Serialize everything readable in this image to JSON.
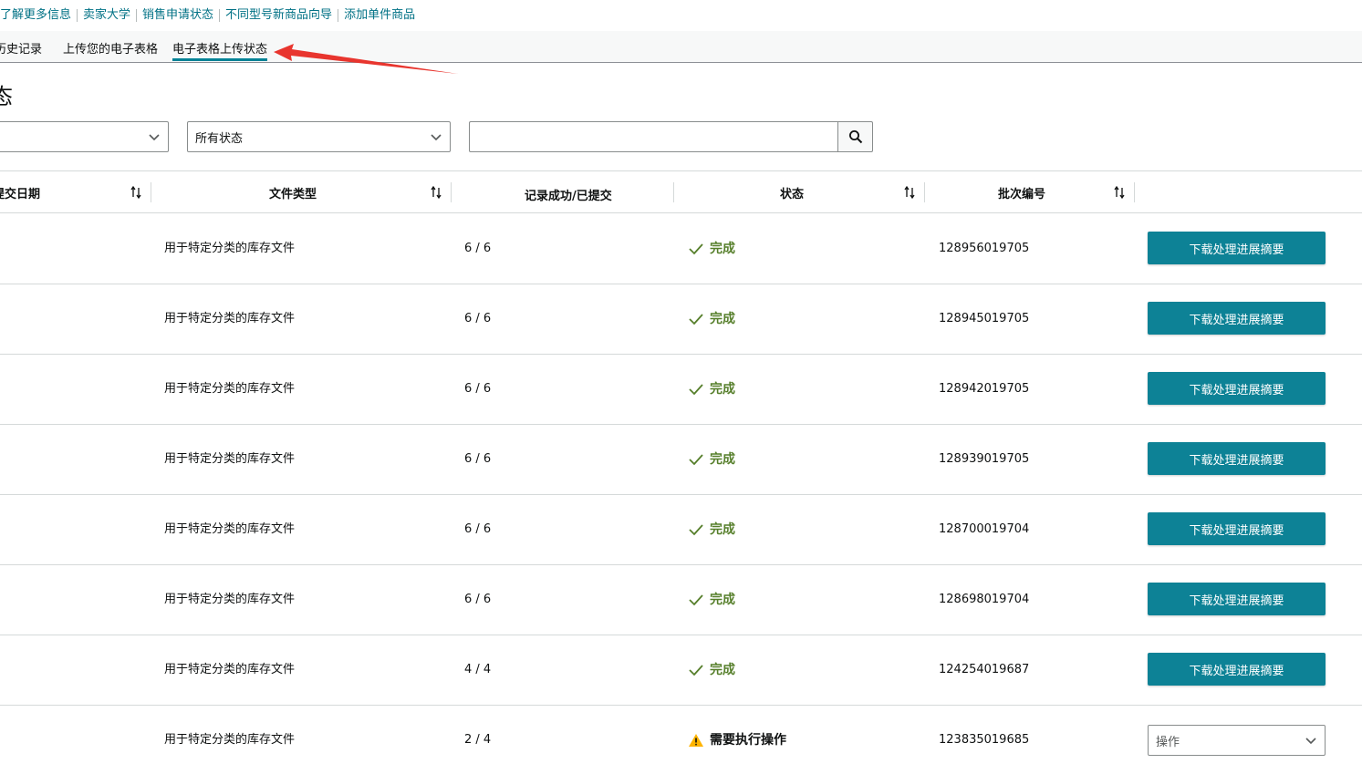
{
  "top_links": [
    "了解更多信息",
    "卖家大学",
    "销售申请状态",
    "不同型号新商品向导",
    "添加单件商品"
  ],
  "tabs": [
    {
      "label": "历史记录",
      "active": false
    },
    {
      "label": "上传您的电子表格",
      "active": false
    },
    {
      "label": "电子表格上传状态",
      "active": true
    }
  ],
  "page_title": "态",
  "filters": {
    "first_select_value": "",
    "status_select_value": "所有状态",
    "search_value": "",
    "search_icon": "search-icon"
  },
  "table": {
    "headers": [
      "提交日期",
      "文件类型",
      "记录成功/已提交",
      "状态",
      "批次编号",
      ""
    ],
    "rows": [
      {
        "file_type": "用于特定分类的库存文件",
        "records": "6 / 6",
        "status": "完成",
        "status_kind": "done",
        "batch": "128956019705",
        "action": "下载处理进展摘要"
      },
      {
        "file_type": "用于特定分类的库存文件",
        "records": "6 / 6",
        "status": "完成",
        "status_kind": "done",
        "batch": "128945019705",
        "action": "下载处理进展摘要"
      },
      {
        "file_type": "用于特定分类的库存文件",
        "records": "6 / 6",
        "status": "完成",
        "status_kind": "done",
        "batch": "128942019705",
        "action": "下载处理进展摘要"
      },
      {
        "file_type": "用于特定分类的库存文件",
        "records": "6 / 6",
        "status": "完成",
        "status_kind": "done",
        "batch": "128939019705",
        "action": "下载处理进展摘要"
      },
      {
        "file_type": "用于特定分类的库存文件",
        "records": "6 / 6",
        "status": "完成",
        "status_kind": "done",
        "batch": "128700019704",
        "action": "下载处理进展摘要"
      },
      {
        "file_type": "用于特定分类的库存文件",
        "records": "6 / 6",
        "status": "完成",
        "status_kind": "done",
        "batch": "128698019704",
        "action": "下载处理进展摘要"
      },
      {
        "file_type": "用于特定分类的库存文件",
        "records": "4 / 4",
        "status": "完成",
        "status_kind": "done",
        "batch": "124254019687",
        "action": "下载处理进展摘要"
      },
      {
        "file_type": "用于特定分类的库存文件",
        "records": "2 / 4",
        "status": "需要执行操作",
        "status_kind": "warn",
        "batch": "123835019685",
        "action": "操作"
      }
    ]
  },
  "colors": {
    "accent": "#008296",
    "button_bg": "#0d8296",
    "link": "#007185",
    "done_text": "#567f2b",
    "warn_icon": "#ffb400",
    "annotation_arrow": "#e8352e"
  }
}
